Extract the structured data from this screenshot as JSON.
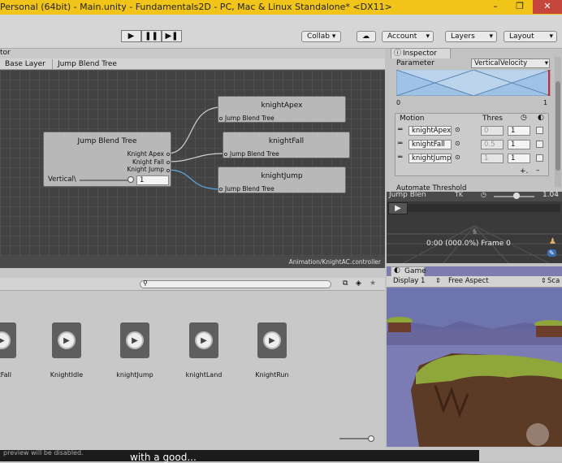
{
  "window": {
    "title": "Personal (64bit) - Main.unity - Fundamentals2D - PC, Mac & Linux Standalone* <DX11>",
    "min_label": "–",
    "max_label": "❐",
    "close_label": "✕"
  },
  "toolbar": {
    "play_label": "▶",
    "pause_label": "❚❚",
    "step_label": "▶❚",
    "collab_label": "Collab ▾",
    "account_label": "Account",
    "layers_label": "Layers",
    "layout_label": "Layout"
  },
  "animator": {
    "tab_label": "tor",
    "breadcrumb": [
      "Base Layer",
      "Jump Blend Tree"
    ],
    "root_node": {
      "title": "Jump Blend Tree",
      "outputs": [
        "Knight Apex",
        "Knight Fall",
        "Knight Jump"
      ],
      "param_label": "Vertical\\",
      "param_value": "1"
    },
    "child_nodes": [
      {
        "title": "knightApex",
        "sub": "Jump Blend Tree"
      },
      {
        "title": "knightFall",
        "sub": "Jump Blend Tree"
      },
      {
        "title": "knightJump",
        "sub": "Jump Blend Tree"
      }
    ],
    "status_path": "Animation/KnightAC.controller"
  },
  "project": {
    "clips": [
      "tFall",
      "KnightIdle",
      "knightJump",
      "knightLand",
      "KnightRun"
    ],
    "footer_text": "preview will be disabled."
  },
  "inspector": {
    "tab_label": "Inspector",
    "parameter_label": "Parameter",
    "parameter_value": "VerticalVelocity",
    "range_min": "0",
    "range_max": "1",
    "motion_header": "Motion",
    "thres_header": "Thres",
    "motions": [
      {
        "name": "knightApex",
        "threshold": "0",
        "speed": "1"
      },
      {
        "name": "knightFall",
        "threshold": "0.5",
        "speed": "1"
      },
      {
        "name": "knightJump",
        "threshold": "1",
        "speed": "1"
      }
    ],
    "add_label": "+.",
    "remove_label": "–",
    "auto_threshold_label": "Automate Threshold"
  },
  "preview": {
    "title": "Jump Blen",
    "speed_value": "1.04",
    "time_readout": "0:00 (000.0%) Frame 0"
  },
  "game": {
    "tab_label": "Game",
    "display_label": "Display 1",
    "aspect_label": "Free Aspect",
    "scale_label": "Sca"
  },
  "subtitle_text": "with a good...",
  "colors": {
    "titlebar": "#f0c419",
    "graph_bg": "#434343",
    "node_bg": "#b8b8b8",
    "connector": "#d0d0d0",
    "game_sky": "#7c7cb0",
    "ground_green": "#8fa63a"
  }
}
